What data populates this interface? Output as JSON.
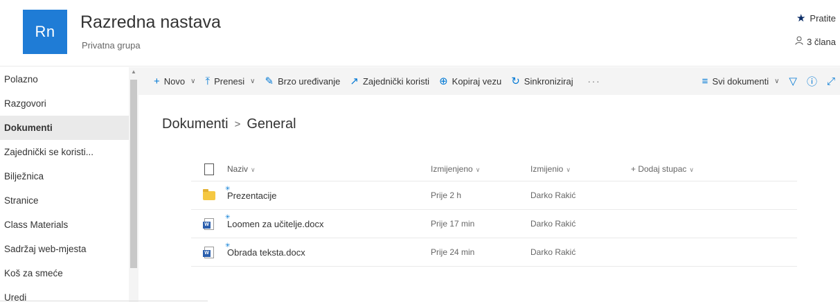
{
  "header": {
    "logo_text": "Rn",
    "title": "Razredna nastava",
    "subtitle": "Privatna grupa",
    "follow_label": "Pratite",
    "members_label": "3 člana"
  },
  "nav": {
    "items": [
      {
        "label": "Polazno",
        "active": false
      },
      {
        "label": "Razgovori",
        "active": false
      },
      {
        "label": "Dokumenti",
        "active": true
      },
      {
        "label": "Zajednički se koristi...",
        "active": false
      },
      {
        "label": "Bilježnica",
        "active": false
      },
      {
        "label": "Stranice",
        "active": false
      },
      {
        "label": "Class Materials",
        "active": false
      },
      {
        "label": "Sadržaj web-mjesta",
        "active": false
      },
      {
        "label": "Koš za smeće",
        "active": false
      },
      {
        "label": "Uredi",
        "active": false
      }
    ]
  },
  "toolbar": {
    "new_label": "Novo",
    "upload_label": "Prenesi",
    "quick_edit_label": "Brzo uređivanje",
    "share_label": "Zajednički koristi",
    "copy_link_label": "Kopiraj vezu",
    "sync_label": "Sinkroniziraj",
    "more_label": "···",
    "view_label": "Svi dokumenti"
  },
  "breadcrumb": {
    "root": "Dokumenti",
    "separator": ">",
    "current": "General"
  },
  "table": {
    "columns": {
      "name": "Naziv",
      "modified": "Izmijenjeno",
      "modified_by": "Izmijenio",
      "add_column": "+ Dodaj stupac"
    },
    "rows": [
      {
        "type": "folder",
        "name": "Prezentacije",
        "modified": "Prije 2 h",
        "modified_by": "Darko Rakić"
      },
      {
        "type": "word",
        "name": "Loomen za učitelje.docx",
        "modified": "Prije 17 min",
        "modified_by": "Darko Rakić"
      },
      {
        "type": "word",
        "name": "Obrada teksta.docx",
        "modified": "Prije 24 min",
        "modified_by": "Darko Rakić"
      }
    ]
  },
  "colors": {
    "brand": "#1f7cd6",
    "accent": "#0078d4",
    "folder": "#f5c842",
    "word": "#2b5fad"
  }
}
